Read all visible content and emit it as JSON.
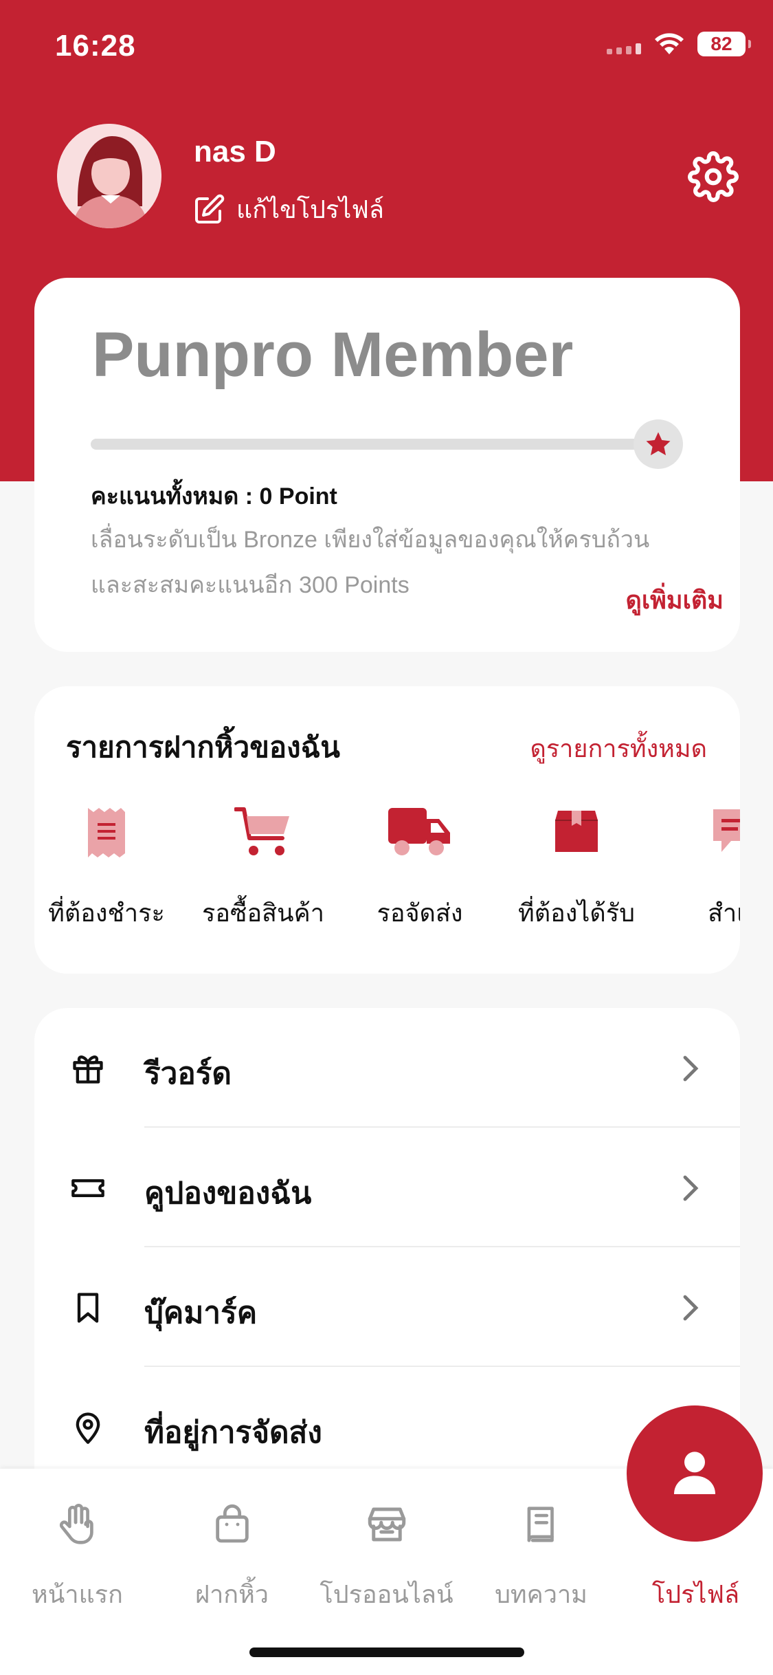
{
  "status": {
    "time": "16:28",
    "battery": "82"
  },
  "profile": {
    "name": "nas D",
    "edit_label": "แก้ไขโปรไฟล์"
  },
  "member": {
    "title": "Punpro Member",
    "progress": 0,
    "points_label": "คะแนนทั้งหมด : 0 Point",
    "desc_line1": "เลื่อนระดับเป็น Bronze เพียงใส่ข้อมูลของคุณให้ครบถ้วน",
    "desc_line2": "และสะสมคะแนนอีก 300 Points",
    "see_more": "ดูเพิ่มเติม"
  },
  "deposit": {
    "title": "รายการฝากหิ้วของฉัน",
    "view_all": "ดูรายการทั้งหมด",
    "steps": [
      {
        "label": "ที่ต้องชำระ",
        "icon": "receipt-icon"
      },
      {
        "label": "รอซื้อสินค้า",
        "icon": "cart-icon"
      },
      {
        "label": "รอจัดส่ง",
        "icon": "truck-icon"
      },
      {
        "label": "ที่ต้องได้รับ",
        "icon": "box-icon"
      },
      {
        "label": "สำเร็",
        "icon": "message-icon"
      }
    ]
  },
  "menu": [
    {
      "label": "รีวอร์ด",
      "icon": "gift-icon"
    },
    {
      "label": "คูปองของฉัน",
      "icon": "ticket-icon"
    },
    {
      "label": "บุ๊คมาร์ค",
      "icon": "bookmark-icon"
    },
    {
      "label": "ที่อยู่การจัดส่ง",
      "icon": "location-pin-icon"
    }
  ],
  "nav": [
    {
      "label": "หน้าแรก",
      "icon": "hand-icon"
    },
    {
      "label": "ฝากหิ้ว",
      "icon": "bag-icon"
    },
    {
      "label": "โปรออนไลน์",
      "icon": "store-icon"
    },
    {
      "label": "บทความ",
      "icon": "book-icon"
    },
    {
      "label": "โปรไฟล์",
      "icon": "user-icon"
    }
  ],
  "colors": {
    "brand": "#c32232",
    "muted": "#9a9a9a"
  }
}
